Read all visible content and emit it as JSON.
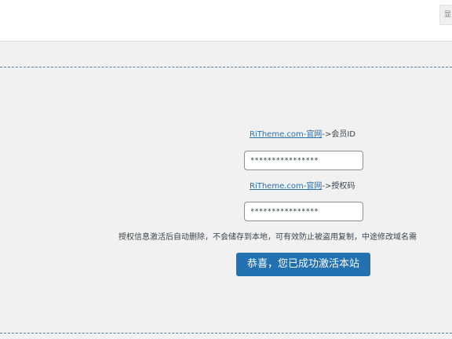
{
  "topbar": {
    "tab_label": "显"
  },
  "activation": {
    "member_id": {
      "link_text": "RiTheme.com-官网",
      "suffix": "->会员ID",
      "value": "****************"
    },
    "license_code": {
      "link_text": "RiTheme.com-官网",
      "suffix": "->授权码",
      "value": "****************"
    },
    "notice": "授权信息激活后自动删除，不会储存到本地，可有效防止被盗用复制，中途修改域名需",
    "activate_button_label": "恭喜，您已成功激活本站"
  },
  "colors": {
    "accent": "#2271b1",
    "panel_border": "#4f7fa8",
    "background": "#f1f1f1"
  }
}
